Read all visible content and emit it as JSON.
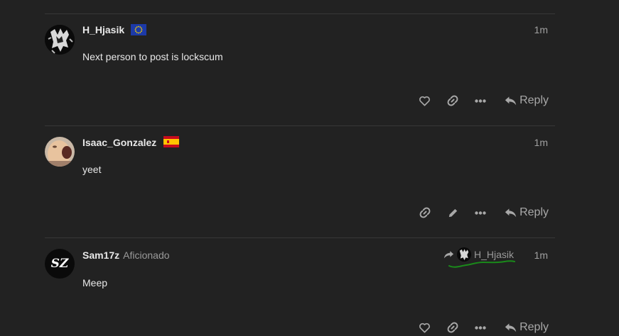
{
  "posts": [
    {
      "username": "H_Hjasik",
      "flag": "eu-flag",
      "time": "1m",
      "text": "Next person to post is lockscum",
      "actions": [
        "like-icon",
        "link-icon",
        "more-icon"
      ],
      "reply_label": "Reply"
    },
    {
      "username": "Isaac_Gonzalez",
      "flag": "spain-flag",
      "time": "1m",
      "text": "yeet",
      "actions": [
        "link-icon",
        "edit-icon",
        "more-icon"
      ],
      "reply_label": "Reply"
    },
    {
      "username": "Sam17z",
      "user_title": "Aficionado",
      "reply_to": "H_Hjasik",
      "time": "1m",
      "text": "Meep",
      "avatar_text": "SZ",
      "actions": [
        "like-icon",
        "link-icon",
        "more-icon"
      ],
      "reply_label": "Reply"
    }
  ],
  "colors": {
    "background": "#222222",
    "divider": "#383838",
    "annotation": "#1a8a1a"
  }
}
